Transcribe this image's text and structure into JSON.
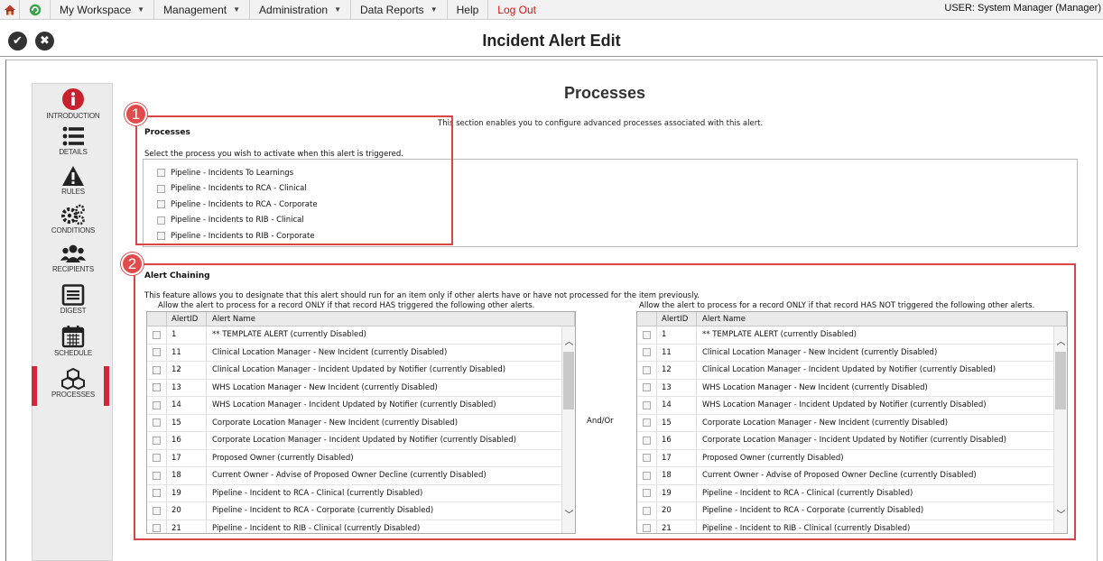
{
  "topbar": {
    "menu": [
      {
        "label": "My Workspace",
        "has_caret": true
      },
      {
        "label": "Management",
        "has_caret": true
      },
      {
        "label": "Administration",
        "has_caret": true
      },
      {
        "label": "Data Reports",
        "has_caret": true
      },
      {
        "label": "Help",
        "has_caret": false
      },
      {
        "label": "Log Out",
        "has_caret": false
      }
    ],
    "user": "USER: System Manager (Manager)",
    "icons": [
      "home-icon",
      "refresh-icon"
    ]
  },
  "titlebar": {
    "title": "Incident Alert Edit",
    "save_icon": "✔",
    "cancel_icon": "✖"
  },
  "sidebar": {
    "items": [
      {
        "label": "INTRODUCTION",
        "icon": "info-icon"
      },
      {
        "label": "DETAILS",
        "icon": "list-icon"
      },
      {
        "label": "RULES",
        "icon": "warning-icon"
      },
      {
        "label": "CONDITIONS",
        "icon": "gears-icon"
      },
      {
        "label": "RECIPIENTS",
        "icon": "people-icon"
      },
      {
        "label": "DIGEST",
        "icon": "digest-icon"
      },
      {
        "label": "SCHEDULE",
        "icon": "calendar-icon"
      },
      {
        "label": "PROCESSES",
        "icon": "cubes-icon"
      }
    ],
    "active": "PROCESSES",
    "active_color": "#d3263a"
  },
  "main": {
    "heading": "Processes",
    "description": "This section enables you to configure advanced processes associated with this alert."
  },
  "processes": {
    "title": "Processes",
    "subtitle": "Select the process you wish to activate when this alert is triggered.",
    "items": [
      "Pipeline - Incidents To Learnings",
      "Pipeline - Incidents to RCA - Clinical",
      "Pipeline - Incidents to RCA - Corporate",
      "Pipeline - Incidents to RIB - Clinical",
      "Pipeline - Incidents to RIB - Corporate"
    ]
  },
  "annotations": {
    "one": "1",
    "two": "2",
    "color": "#d94545"
  },
  "chaining": {
    "title": "Alert Chaining",
    "description": "This feature allows you to designate that this alert should run for an item only if other alerts have or have not processed for the item previously.",
    "left_caption": "Allow the alert to process for a record ONLY if that record HAS triggered the following other alerts.",
    "right_caption": "Allow the alert to process for a record ONLY if that record HAS NOT triggered the following other alerts.",
    "andor": "And/Or",
    "columns": {
      "id": "AlertID",
      "name": "Alert Name"
    },
    "rows": [
      {
        "id": "1",
        "name": "** TEMPLATE ALERT (currently Disabled)"
      },
      {
        "id": "11",
        "name": "Clinical Location Manager - New Incident (currently Disabled)"
      },
      {
        "id": "12",
        "name": "Clinical Location Manager - Incident Updated by Notifier (currently Disabled)"
      },
      {
        "id": "13",
        "name": "WHS Location Manager - New Incident (currently Disabled)"
      },
      {
        "id": "14",
        "name": "WHS Location Manager - Incident Updated by Notifier (currently Disabled)"
      },
      {
        "id": "15",
        "name": "Corporate Location Manager - New Incident (currently Disabled)"
      },
      {
        "id": "16",
        "name": "Corporate Location Manager - Incident Updated by Notifier (currently Disabled)"
      },
      {
        "id": "17",
        "name": "Proposed Owner (currently Disabled)"
      },
      {
        "id": "18",
        "name": "Current Owner - Advise of Proposed Owner Decline (currently Disabled)"
      },
      {
        "id": "19",
        "name": "Pipeline - Incident to RCA - Clinical (currently Disabled)"
      },
      {
        "id": "20",
        "name": "Pipeline - Incident to RCA - Corporate (currently Disabled)"
      },
      {
        "id": "21",
        "name": "Pipeline - Incident to RIB - Clinical (currently Disabled)"
      }
    ]
  }
}
